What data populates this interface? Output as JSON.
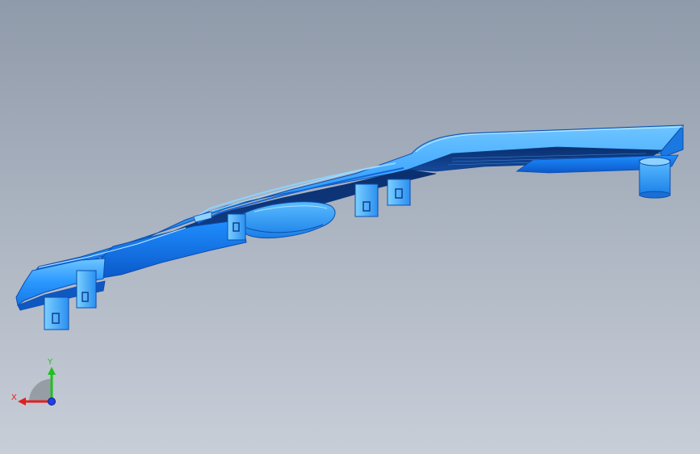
{
  "viewport": {
    "background_top": "#8f9aaa",
    "background_bottom": "#c8ced8"
  },
  "model": {
    "color_main": "#1f8fff",
    "color_light": "#4fb4ff",
    "color_highlight": "#8fd2ff",
    "color_dark": "#0c3f8f",
    "color_shadow": "#082b63"
  },
  "triad": {
    "x_label": "X",
    "y_label": "Y",
    "x_color": "#e02020",
    "y_color": "#20c020",
    "z_color": "#2040e0",
    "x_icon": "x-axis-arrow-icon",
    "y_icon": "y-axis-arrow-icon",
    "z_icon": "z-axis-dot-icon"
  }
}
